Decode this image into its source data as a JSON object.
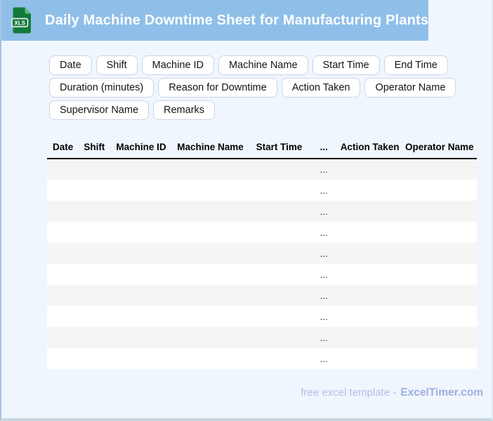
{
  "header": {
    "title": "Daily Machine Downtime Sheet for Manufacturing Plants",
    "file_icon_label": "XLS"
  },
  "chips": {
    "rows": [
      [
        "Date",
        "Shift",
        "Machine ID",
        "Machine Name",
        "Start Time",
        "End Time"
      ],
      [
        "Duration (minutes)",
        "Reason for Downtime",
        "Action Taken",
        "Operator Name"
      ],
      [
        "Supervisor Name",
        "Remarks"
      ]
    ]
  },
  "table": {
    "columns": [
      "Date",
      "Shift",
      "Machine ID",
      "Machine Name",
      "Start Time",
      "...",
      "Action Taken",
      "Operator Name"
    ],
    "rows": [
      [
        "",
        "",
        "",
        "",
        "",
        "...",
        "",
        ""
      ],
      [
        "",
        "",
        "",
        "",
        "",
        "...",
        "",
        ""
      ],
      [
        "",
        "",
        "",
        "",
        "",
        "...",
        "",
        ""
      ],
      [
        "",
        "",
        "",
        "",
        "",
        "...",
        "",
        ""
      ],
      [
        "",
        "",
        "",
        "",
        "",
        "...",
        "",
        ""
      ],
      [
        "",
        "",
        "",
        "",
        "",
        "...",
        "",
        ""
      ],
      [
        "",
        "",
        "",
        "",
        "",
        "...",
        "",
        ""
      ],
      [
        "",
        "",
        "",
        "",
        "",
        "...",
        "",
        ""
      ],
      [
        "",
        "",
        "",
        "",
        "",
        "...",
        "",
        ""
      ],
      [
        "",
        "",
        "",
        "",
        "",
        "...",
        "",
        ""
      ]
    ]
  },
  "footer": {
    "text": "free excel template -",
    "brand": "ExcelTimer.com"
  },
  "colors": {
    "banner": "#8FBFE9",
    "page_background": "#F0F6FD",
    "row_alternate": "#F5F5F6",
    "icon_green": "#147A3C",
    "icon_fold_green": "#5FB57E",
    "footer_text": "#B3BFE9",
    "footer_brand": "#9FAFE0"
  }
}
